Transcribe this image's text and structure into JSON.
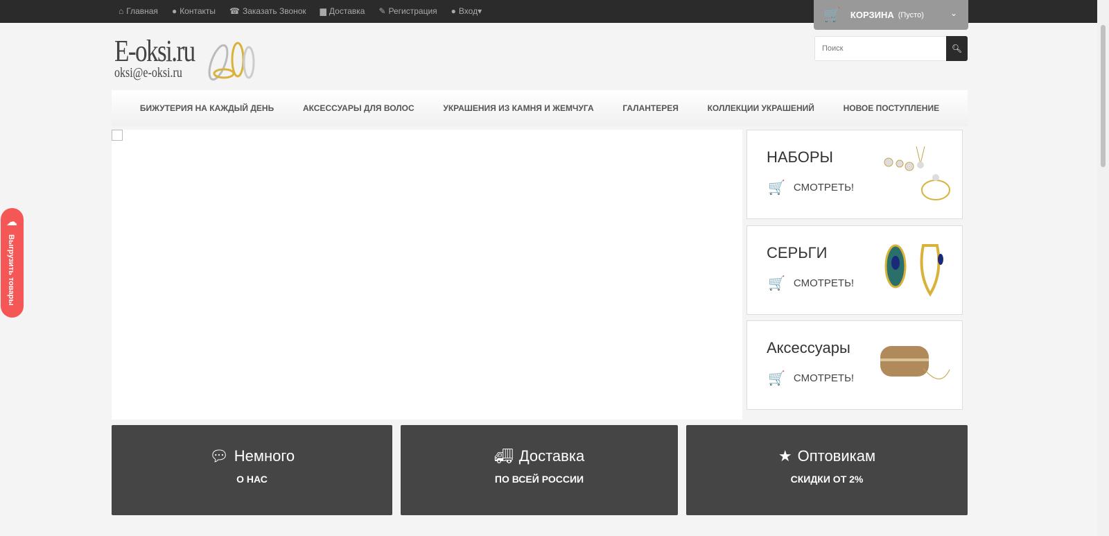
{
  "topnav": [
    {
      "icon": "home-icon",
      "label": "Главная"
    },
    {
      "icon": "map-marker-icon",
      "label": "Контакты"
    },
    {
      "icon": "phone-icon",
      "label": "Заказать Звонок"
    },
    {
      "icon": "truck-icon",
      "label": "Доставка"
    },
    {
      "icon": "edit-icon",
      "label": "Регистрация"
    },
    {
      "icon": "user-icon",
      "label": "Вход"
    }
  ],
  "cart": {
    "label": "КОРЗИНА",
    "status": "(Пусто)"
  },
  "search": {
    "placeholder": "Поиск"
  },
  "logo": {
    "title": "E-oksi.ru",
    "email": "oksi@e-oksi.ru"
  },
  "menu": [
    "БИЖУТЕРИЯ НА КАЖДЫЙ ДЕНЬ",
    "АКСЕССУАРЫ ДЛЯ ВОЛОС",
    "УКРАШЕНИЯ ИЗ КАМНЯ И ЖЕМЧУГА",
    "ГАЛАНТЕРЕЯ",
    "КОЛЛЕКЦИИ УКРАШЕНИЙ",
    "НОВОЕ ПОСТУПЛЕНИЕ"
  ],
  "categories": [
    {
      "title": "НАБОРЫ",
      "link": "СМОТРЕТЬ!"
    },
    {
      "title": "СЕРЬГИ",
      "link": "СМОТРЕТЬ!"
    },
    {
      "title": "Аксессуары",
      "link": "СМОТРЕТЬ!"
    }
  ],
  "features": [
    {
      "icon": "comments-icon",
      "title": "Немного",
      "sub": "О НАС"
    },
    {
      "icon": "truck-icon",
      "title": "Доставка",
      "sub": "ПО ВСЕЙ РОССИИ"
    },
    {
      "icon": "star-icon",
      "title": "Оптовикам",
      "sub": "СКИДКИ ОТ 2%"
    }
  ],
  "side_widget": {
    "label": "Выгрузить товары"
  }
}
